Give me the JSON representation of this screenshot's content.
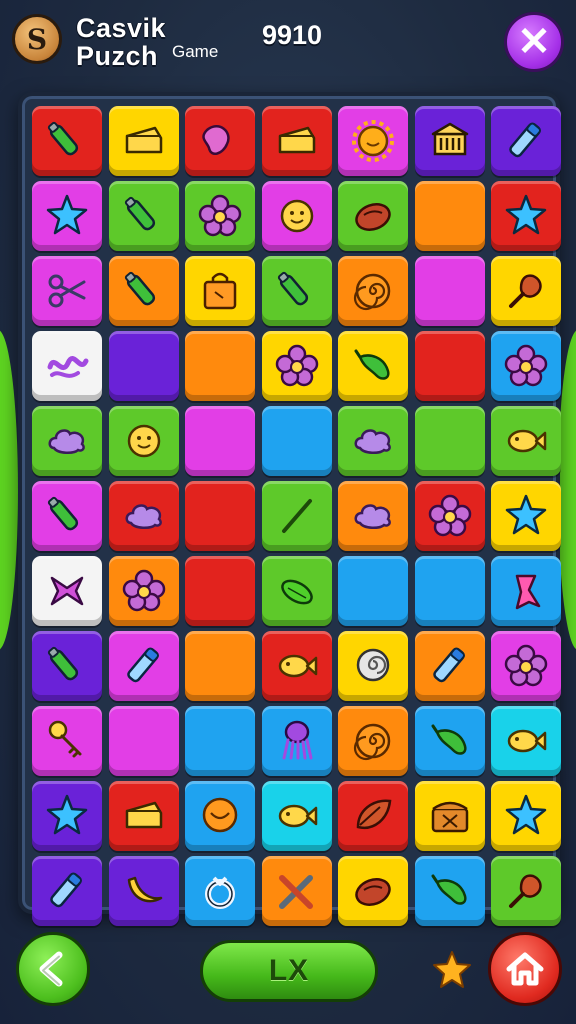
{
  "header": {
    "title_line1": "Casvik",
    "title_line2": "Puzch",
    "title_sub": "Game",
    "score": "9910",
    "logo_glyph": "S",
    "close_glyph": "✕"
  },
  "footer": {
    "action_label": "LX"
  },
  "colors": {
    "red": "#e2231e",
    "yellow": "#ffd600",
    "magenta": "#e23ee6",
    "purple": "#6a22d8",
    "green": "#5ec92a",
    "orange": "#ff8a0d",
    "blue": "#1fa3f0",
    "cyan": "#19d2ea",
    "white": "#f4f4f4"
  },
  "board": {
    "rows": [
      [
        {
          "color": "red",
          "icon": "bottle-icon"
        },
        {
          "color": "yellow",
          "icon": "cheese-icon"
        },
        {
          "color": "red",
          "icon": "bean-icon"
        },
        {
          "color": "red",
          "icon": "cheese-icon"
        },
        {
          "color": "magenta",
          "icon": "sun-icon"
        },
        {
          "color": "purple",
          "icon": "building-icon"
        },
        {
          "color": "purple",
          "icon": "tube-icon"
        }
      ],
      [
        {
          "color": "magenta",
          "icon": "star-icon"
        },
        {
          "color": "green",
          "icon": "bottle-icon"
        },
        {
          "color": "green",
          "icon": "flower-icon"
        },
        {
          "color": "magenta",
          "icon": "face-icon"
        },
        {
          "color": "green",
          "icon": "bread-icon"
        },
        {
          "color": "orange",
          "icon": ""
        },
        {
          "color": "red",
          "icon": "star-icon"
        }
      ],
      [
        {
          "color": "magenta",
          "icon": "scissors-icon"
        },
        {
          "color": "orange",
          "icon": "bottle-icon"
        },
        {
          "color": "yellow",
          "icon": "bag-icon"
        },
        {
          "color": "green",
          "icon": "bottle-icon"
        },
        {
          "color": "orange",
          "icon": "swirl-icon"
        },
        {
          "color": "magenta",
          "icon": ""
        },
        {
          "color": "yellow",
          "icon": "drumstick-icon"
        }
      ],
      [
        {
          "color": "white",
          "icon": "knot-icon"
        },
        {
          "color": "purple",
          "icon": ""
        },
        {
          "color": "orange",
          "icon": ""
        },
        {
          "color": "yellow",
          "icon": "flower-icon"
        },
        {
          "color": "yellow",
          "icon": "pepper-icon"
        },
        {
          "color": "red",
          "icon": ""
        },
        {
          "color": "blue",
          "icon": "flower-icon"
        }
      ],
      [
        {
          "color": "green",
          "icon": "cloud-icon"
        },
        {
          "color": "green",
          "icon": "face-icon"
        },
        {
          "color": "magenta",
          "icon": ""
        },
        {
          "color": "blue",
          "icon": ""
        },
        {
          "color": "green",
          "icon": "cloud-icon"
        },
        {
          "color": "green",
          "icon": ""
        },
        {
          "color": "green",
          "icon": "fish-icon"
        }
      ],
      [
        {
          "color": "magenta",
          "icon": "bottle-icon"
        },
        {
          "color": "red",
          "icon": "cloud-icon"
        },
        {
          "color": "red",
          "icon": ""
        },
        {
          "color": "green",
          "icon": "stick-icon"
        },
        {
          "color": "orange",
          "icon": "cloud-icon"
        },
        {
          "color": "red",
          "icon": "flower-icon"
        },
        {
          "color": "yellow",
          "icon": "star-icon"
        }
      ],
      [
        {
          "color": "white",
          "icon": "bow-icon"
        },
        {
          "color": "orange",
          "icon": "flower-icon"
        },
        {
          "color": "red",
          "icon": ""
        },
        {
          "color": "green",
          "icon": "pickle-icon"
        },
        {
          "color": "blue",
          "icon": ""
        },
        {
          "color": "blue",
          "icon": ""
        },
        {
          "color": "blue",
          "icon": "ribbon-icon"
        }
      ],
      [
        {
          "color": "purple",
          "icon": "bottle-icon"
        },
        {
          "color": "magenta",
          "icon": "tube-icon"
        },
        {
          "color": "orange",
          "icon": ""
        },
        {
          "color": "red",
          "icon": "fish-icon"
        },
        {
          "color": "yellow",
          "icon": "snail-icon"
        },
        {
          "color": "orange",
          "icon": "tube-icon"
        },
        {
          "color": "magenta",
          "icon": "flower-icon"
        }
      ],
      [
        {
          "color": "magenta",
          "icon": "key-icon"
        },
        {
          "color": "magenta",
          "icon": ""
        },
        {
          "color": "blue",
          "icon": ""
        },
        {
          "color": "blue",
          "icon": "squid-icon"
        },
        {
          "color": "orange",
          "icon": "swirl-icon"
        },
        {
          "color": "blue",
          "icon": "pepper-icon"
        },
        {
          "color": "cyan",
          "icon": "fish-icon"
        }
      ],
      [
        {
          "color": "purple",
          "icon": "star-icon"
        },
        {
          "color": "red",
          "icon": "cheese-icon"
        },
        {
          "color": "blue",
          "icon": "bun-icon"
        },
        {
          "color": "cyan",
          "icon": "fish-icon"
        },
        {
          "color": "red",
          "icon": "leaf-icon"
        },
        {
          "color": "yellow",
          "icon": "chest-icon"
        },
        {
          "color": "yellow",
          "icon": "star-icon"
        }
      ],
      [
        {
          "color": "purple",
          "icon": "tube-icon"
        },
        {
          "color": "purple",
          "icon": "banana-icon"
        },
        {
          "color": "blue",
          "icon": "ring-icon"
        },
        {
          "color": "orange",
          "icon": "tools-icon"
        },
        {
          "color": "yellow",
          "icon": "bread-icon"
        },
        {
          "color": "blue",
          "icon": "pepper-icon"
        },
        {
          "color": "green",
          "icon": "drumstick-icon"
        }
      ]
    ]
  }
}
